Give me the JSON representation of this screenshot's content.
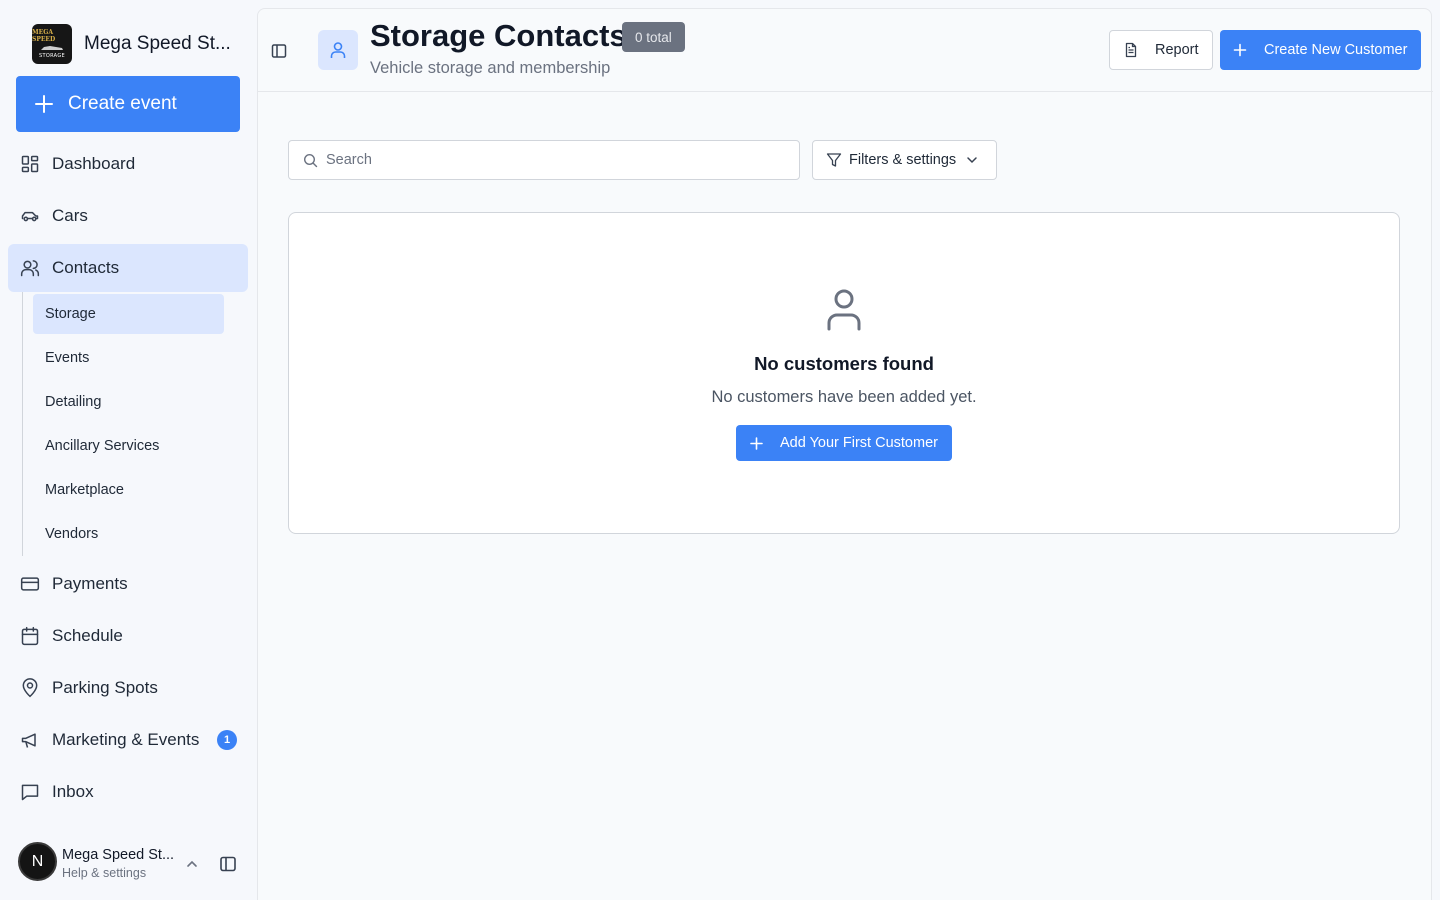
{
  "sidebar": {
    "brand": {
      "name": "Mega Speed St...",
      "logo_line1": "MEGA SPEED",
      "logo_line2": "STORAGE"
    },
    "create_event_label": "Create event",
    "nav": [
      {
        "label": "Dashboard",
        "icon": "dashboard-grid-icon"
      },
      {
        "label": "Cars",
        "icon": "car-icon"
      },
      {
        "label": "Contacts",
        "icon": "users-icon",
        "active": true
      },
      {
        "label": "Payments",
        "icon": "credit-card-icon"
      },
      {
        "label": "Schedule",
        "icon": "calendar-icon"
      },
      {
        "label": "Parking Spots",
        "icon": "map-pin-icon"
      },
      {
        "label": "Marketing & Events",
        "icon": "megaphone-icon",
        "badge": "1"
      },
      {
        "label": "Inbox",
        "icon": "message-square-icon"
      }
    ],
    "contacts_subnav": [
      {
        "label": "Storage",
        "active": true
      },
      {
        "label": "Events"
      },
      {
        "label": "Detailing"
      },
      {
        "label": "Ancillary Services"
      },
      {
        "label": "Marketplace"
      },
      {
        "label": "Vendors"
      }
    ],
    "account": {
      "initial": "N",
      "name": "Mega Speed St...",
      "subtitle": "Help & settings"
    }
  },
  "header": {
    "title": "Storage Contacts",
    "total_badge": "0 total",
    "subtitle": "Vehicle storage and membership",
    "report_label": "Report",
    "create_label": "Create New Customer"
  },
  "toolbar": {
    "search_placeholder": "Search",
    "filters_label": "Filters & settings"
  },
  "empty_state": {
    "title": "No customers found",
    "description": "No customers have been added yet.",
    "button_label": "Add Your First Customer"
  },
  "colors": {
    "accent": "#3b82f6",
    "active_bg": "#dbe6fe",
    "badge_gray": "#6b7280"
  }
}
